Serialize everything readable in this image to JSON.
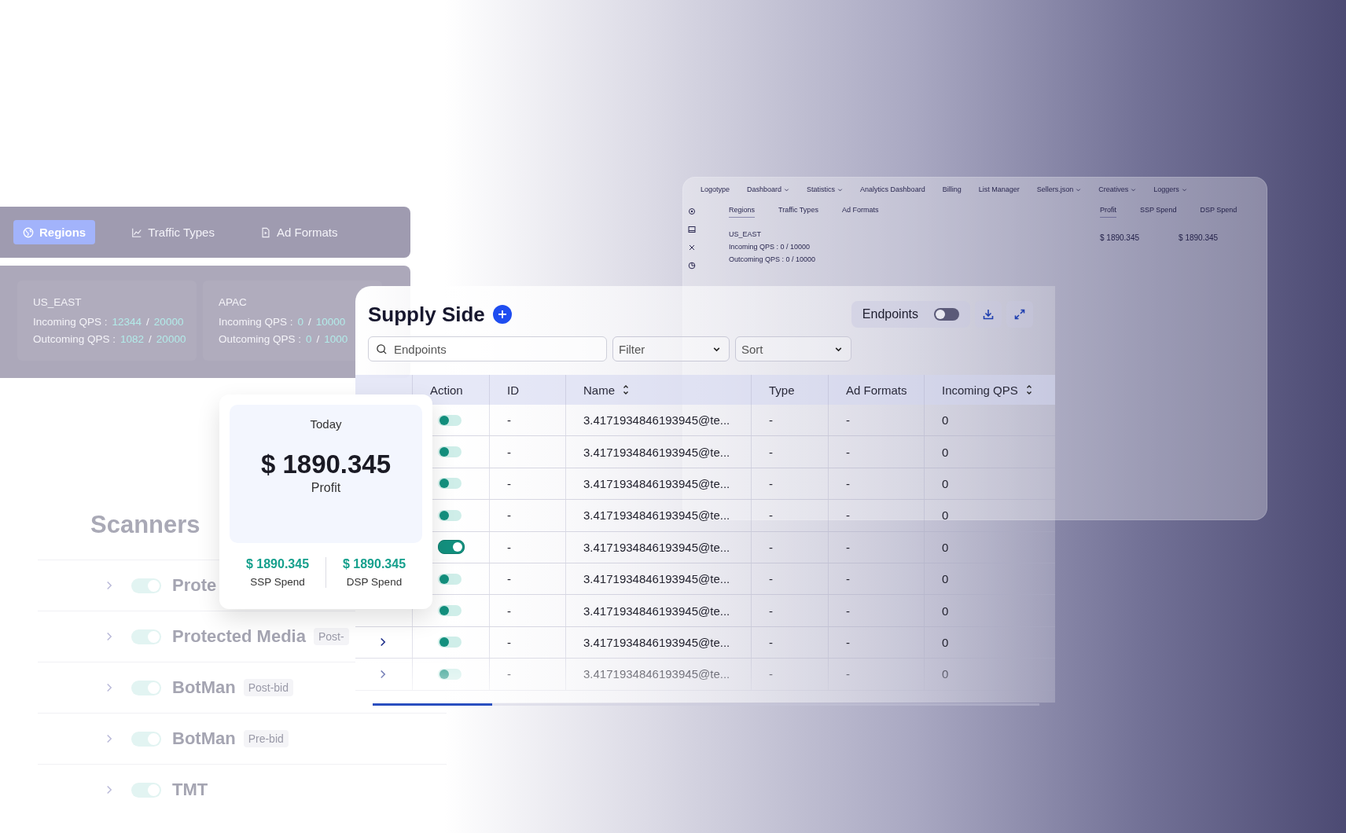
{
  "background_app": {
    "nav": [
      {
        "label": "Logotype",
        "dropdown": false
      },
      {
        "label": "Dashboard",
        "dropdown": true
      },
      {
        "label": "Statistics",
        "dropdown": true
      },
      {
        "label": "Analytics Dashboard",
        "dropdown": false
      },
      {
        "label": "Billing",
        "dropdown": false
      },
      {
        "label": "List Manager",
        "dropdown": false
      },
      {
        "label": "Sellers.json",
        "dropdown": true
      },
      {
        "label": "Creatives",
        "dropdown": true
      },
      {
        "label": "Loggers",
        "dropdown": true
      }
    ],
    "tabs": [
      {
        "label": "Regions",
        "selected": true
      },
      {
        "label": "Traffic Types",
        "selected": false
      },
      {
        "label": "Ad Formats",
        "selected": false
      }
    ],
    "region": {
      "name": "US_EAST",
      "lines": [
        "Incoming QPS : 0 / 10000",
        "Outcoming QPS : 0 / 10000"
      ]
    },
    "stat_tabs": [
      {
        "label": "Profit",
        "selected": true
      },
      {
        "label": "SSP Spend",
        "selected": false
      },
      {
        "label": "DSP Spend",
        "selected": false
      }
    ],
    "stats": [
      "$ 1890.345",
      "$ 1890.345"
    ]
  },
  "region_tabs": [
    {
      "label": "Regions",
      "selected": true
    },
    {
      "label": "Traffic Types",
      "selected": false
    },
    {
      "label": "Ad Formats",
      "selected": false
    }
  ],
  "regions": [
    {
      "name": "US_EAST",
      "lines": [
        {
          "label": "Incoming QPS :",
          "value": "12344",
          "sep": "/",
          "limit": "20000"
        },
        {
          "label": "Outcoming QPS :",
          "value": "1082",
          "sep": "/",
          "limit": "20000"
        }
      ]
    },
    {
      "name": "APAC",
      "lines": [
        {
          "label": "Incoming QPS :",
          "value": "0",
          "sep": "/",
          "limit": "10000"
        },
        {
          "label": "Outcoming QPS :",
          "value": "0",
          "sep": "/",
          "limit": "1000"
        }
      ]
    }
  ],
  "scanners": {
    "title": "Scanners",
    "items": [
      {
        "name": "Prote",
        "on": true
      },
      {
        "name": "Protected Media",
        "tag": "Post-",
        "on": true
      },
      {
        "name": "BotMan",
        "tag": "Post-bid",
        "on": true
      },
      {
        "name": "BotMan",
        "tag": "Pre-bid",
        "on": true
      },
      {
        "name": "TMT",
        "on": true
      }
    ]
  },
  "supply": {
    "title": "Supply Side",
    "endpoints_toggle": {
      "label": "Endpoints",
      "on": false
    },
    "search": {
      "placeholder": "Endpoints"
    },
    "filter": "Filter",
    "sort": "Sort",
    "columns": [
      {
        "label": "Action",
        "sortable": false
      },
      {
        "label": "ID",
        "sortable": false
      },
      {
        "label": "Name",
        "sortable": true
      },
      {
        "label": "Type",
        "sortable": false
      },
      {
        "label": "Ad Formats",
        "sortable": false
      },
      {
        "label": "Incoming QPS",
        "sortable": true
      }
    ],
    "rows": [
      {
        "on": false,
        "id": "-",
        "name": "3.4171934846193945@te...",
        "type": "-",
        "ad_formats": "-",
        "qps": "0"
      },
      {
        "on": false,
        "id": "-",
        "name": "3.4171934846193945@te...",
        "type": "-",
        "ad_formats": "-",
        "qps": "0"
      },
      {
        "on": false,
        "id": "-",
        "name": "3.4171934846193945@te...",
        "type": "-",
        "ad_formats": "-",
        "qps": "0"
      },
      {
        "on": false,
        "id": "-",
        "name": "3.4171934846193945@te...",
        "type": "-",
        "ad_formats": "-",
        "qps": "0"
      },
      {
        "on": true,
        "id": "-",
        "name": "3.4171934846193945@te...",
        "type": "-",
        "ad_formats": "-",
        "qps": "0"
      },
      {
        "on": false,
        "id": "-",
        "name": "3.4171934846193945@te...",
        "type": "-",
        "ad_formats": "-",
        "qps": "0"
      },
      {
        "on": false,
        "id": "-",
        "name": "3.4171934846193945@te...",
        "type": "-",
        "ad_formats": "-",
        "qps": "0"
      },
      {
        "on": false,
        "id": "-",
        "name": "3.4171934846193945@te...",
        "type": "-",
        "ad_formats": "-",
        "qps": "0"
      },
      {
        "on": false,
        "id": "-",
        "name": "3.4171934846193945@te...",
        "type": "-",
        "ad_formats": "-",
        "qps": "0"
      }
    ]
  },
  "profit_card": {
    "period": "Today",
    "amount": "$ 1890.345",
    "label": "Profit",
    "stats": [
      {
        "value": "$ 1890.345",
        "label": "SSP Spend"
      },
      {
        "value": "$ 1890.345",
        "label": "DSP Spend"
      }
    ]
  }
}
